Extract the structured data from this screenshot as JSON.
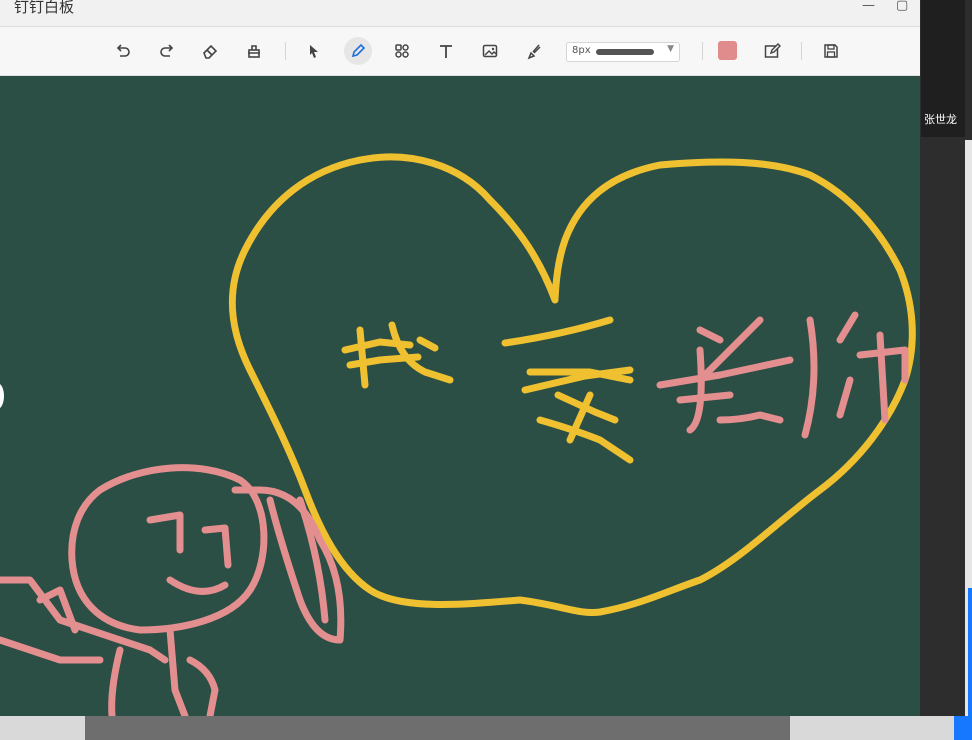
{
  "app": {
    "title": "钉钉白板"
  },
  "window_controls": {
    "minimize": "—",
    "maximize": "▢"
  },
  "toolbar": {
    "tools": [
      {
        "name": "undo-icon"
      },
      {
        "name": "redo-icon"
      },
      {
        "name": "eraser-icon"
      },
      {
        "name": "clear-icon"
      },
      {
        "name": "select-icon"
      },
      {
        "name": "pen-icon",
        "active": true
      },
      {
        "name": "shapes-icon"
      },
      {
        "name": "text-icon"
      },
      {
        "name": "image-icon"
      },
      {
        "name": "brush-icon"
      }
    ],
    "stroke_size": "8px",
    "color": "#e08c8c",
    "extra": [
      {
        "name": "edit-board-icon"
      },
      {
        "name": "save-icon"
      }
    ]
  },
  "participant": {
    "name": "张世龙"
  },
  "canvas": {
    "background": "#2b4e45",
    "ink_yellow": "#efc131",
    "ink_pink": "#e38f8f"
  }
}
